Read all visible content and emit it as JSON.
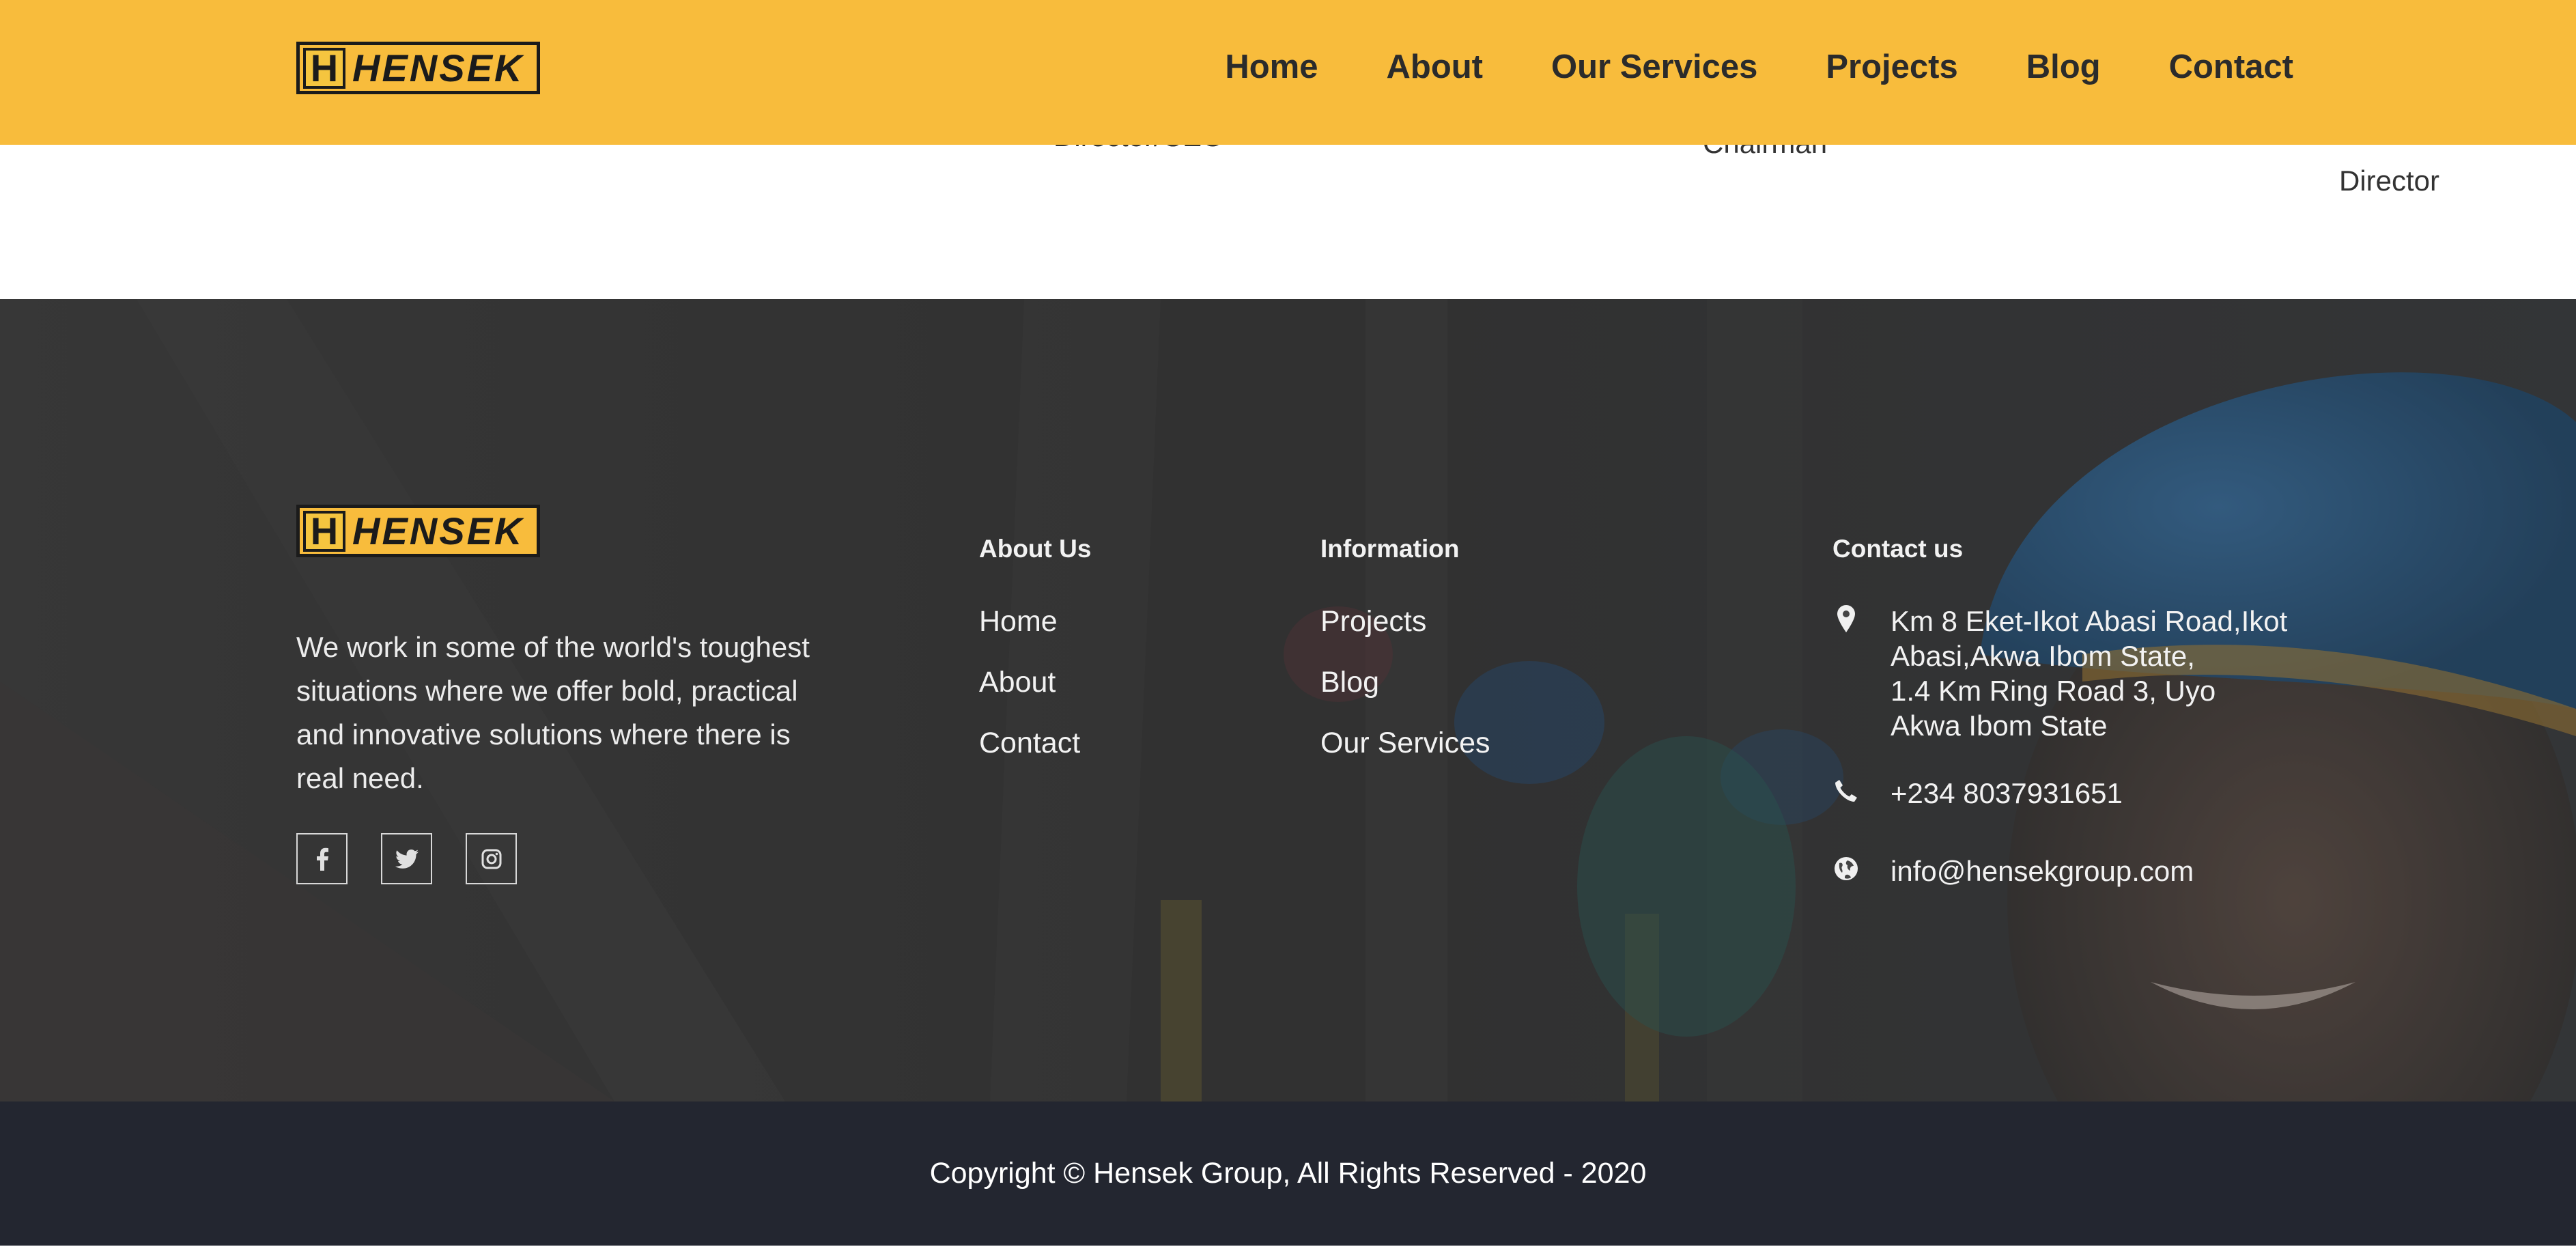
{
  "brand": {
    "name": "HENSEK",
    "logo_letter": "H",
    "accent_color": "#f8bc3c"
  },
  "nav": {
    "items": [
      {
        "label": "Home"
      },
      {
        "label": "About"
      },
      {
        "label": "Our Services"
      },
      {
        "label": "Projects"
      },
      {
        "label": "Blog"
      },
      {
        "label": "Contact"
      }
    ]
  },
  "team": {
    "roles": [
      "Director/CEO",
      "Chairman",
      "Director"
    ]
  },
  "footer": {
    "about_text": "We work in some of the world's toughest situations where we offer bold, practical and innovative solutions where there is real need.",
    "socials": [
      {
        "icon": "facebook-icon"
      },
      {
        "icon": "twitter-icon"
      },
      {
        "icon": "instagram-icon"
      }
    ],
    "about_us": {
      "title": "About Us",
      "links": [
        "Home",
        "About",
        "Contact"
      ]
    },
    "information": {
      "title": "Information",
      "links": [
        "Projects",
        "Blog",
        "Our Services"
      ]
    },
    "contact": {
      "title": "Contact us",
      "address_lines": [
        "Km 8 Eket-Ikot Abasi Road,Ikot",
        "Abasi,Akwa Ibom State,",
        "1.4 Km Ring Road 3, Uyo",
        "Akwa Ibom State"
      ],
      "phone": "+234 8037931651",
      "email": "info@hensekgroup.com"
    }
  },
  "copyright": "Copyright © Hensek Group, All Rights Reserved - 2020"
}
